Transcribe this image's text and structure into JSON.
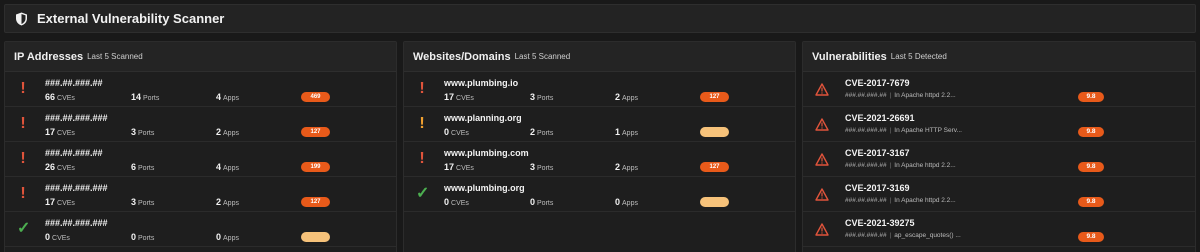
{
  "header": {
    "title": "External Vulnerability Scanner",
    "icon": "shield-icon"
  },
  "ip_panel": {
    "title": "IP Addresses",
    "subtitle": "Last 5 Scanned",
    "rows": [
      {
        "status": "red",
        "name": "###.##.###.##",
        "cves": "66",
        "cves_unit": "CVEs",
        "ports": "14",
        "ports_unit": "Ports",
        "apps": "4",
        "apps_unit": "Apps",
        "badge": "469",
        "badge_style": "orange"
      },
      {
        "status": "red",
        "name": "###.##.###.###",
        "cves": "17",
        "cves_unit": "CVEs",
        "ports": "3",
        "ports_unit": "Ports",
        "apps": "2",
        "apps_unit": "Apps",
        "badge": "127",
        "badge_style": "orange"
      },
      {
        "status": "red",
        "name": "###.##.###.##",
        "cves": "26",
        "cves_unit": "CVEs",
        "ports": "6",
        "ports_unit": "Ports",
        "apps": "4",
        "apps_unit": "Apps",
        "badge": "199",
        "badge_style": "orange"
      },
      {
        "status": "red",
        "name": "###.##.###.###",
        "cves": "17",
        "cves_unit": "CVEs",
        "ports": "3",
        "ports_unit": "Ports",
        "apps": "2",
        "apps_unit": "Apps",
        "badge": "127",
        "badge_style": "orange"
      },
      {
        "status": "green",
        "name": "###.##.###.###",
        "cves": "0",
        "cves_unit": "CVEs",
        "ports": "0",
        "ports_unit": "Ports",
        "apps": "0",
        "apps_unit": "Apps",
        "badge": "",
        "badge_style": "pale"
      }
    ]
  },
  "web_panel": {
    "title": "Websites/Domains",
    "subtitle": "Last 5 Scanned",
    "rows": [
      {
        "status": "red",
        "name": "www.plumbing.io",
        "cves": "17",
        "cves_unit": "CVEs",
        "ports": "3",
        "ports_unit": "Ports",
        "apps": "2",
        "apps_unit": "Apps",
        "badge": "127",
        "badge_style": "orange"
      },
      {
        "status": "yellow",
        "name": "www.planning.org",
        "cves": "0",
        "cves_unit": "CVEs",
        "ports": "2",
        "ports_unit": "Ports",
        "apps": "1",
        "apps_unit": "Apps",
        "badge": "",
        "badge_style": "pale"
      },
      {
        "status": "red",
        "name": "www.plumbing.com",
        "cves": "17",
        "cves_unit": "CVEs",
        "ports": "3",
        "ports_unit": "Ports",
        "apps": "2",
        "apps_unit": "Apps",
        "badge": "127",
        "badge_style": "orange"
      },
      {
        "status": "green",
        "name": "www.plumbing.org",
        "cves": "0",
        "cves_unit": "CVEs",
        "ports": "0",
        "ports_unit": "Ports",
        "apps": "0",
        "apps_unit": "Apps",
        "badge": "",
        "badge_style": "pale"
      }
    ]
  },
  "vuln_panel": {
    "title": "Vulnerabilities",
    "subtitle": "Last 5 Detected",
    "rows": [
      {
        "cve": "CVE-2017-7679",
        "host": "###.##.###.##",
        "desc": "In Apache httpd 2.2...",
        "score": "9.8"
      },
      {
        "cve": "CVE-2021-26691",
        "host": "###.##.###.##",
        "desc": "In Apache HTTP Serv...",
        "score": "9.8"
      },
      {
        "cve": "CVE-2017-3167",
        "host": "###.##.###.##",
        "desc": "In Apache httpd 2.2...",
        "score": "9.8"
      },
      {
        "cve": "CVE-2017-3169",
        "host": "###.##.###.##",
        "desc": "In Apache httpd 2.2...",
        "score": "9.8"
      },
      {
        "cve": "CVE-2021-39275",
        "host": "###.##.###.##",
        "desc": "ap_escape_quotes() ...",
        "score": "9.8"
      }
    ]
  },
  "colors": {
    "accent": "#e85a1a",
    "pale": "#f6c27a",
    "danger": "#e0543b",
    "warning": "#f0a030",
    "ok": "#4caf50"
  }
}
